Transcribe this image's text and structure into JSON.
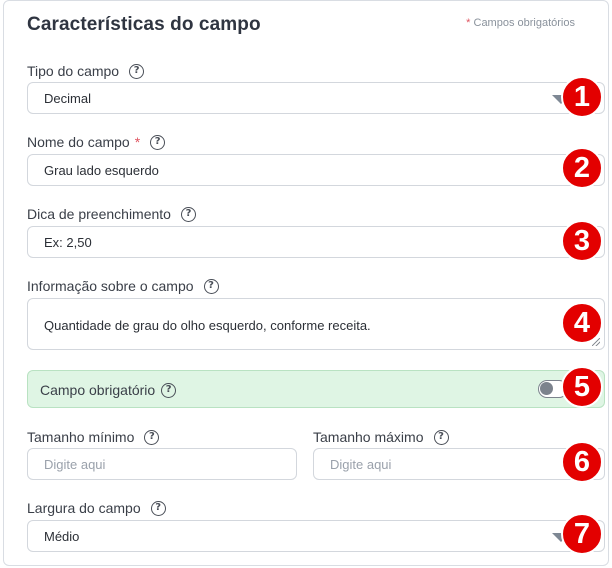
{
  "panel": {
    "title": "Características do campo",
    "required_note_star": "*",
    "required_note": "Campos obrigatórios"
  },
  "help_glyph": "?",
  "fields": {
    "tipo": {
      "label": "Tipo do campo",
      "value": "Decimal"
    },
    "nome": {
      "label": "Nome do campo",
      "required_star": "*",
      "value": "Grau lado esquerdo"
    },
    "dica": {
      "label": "Dica de preenchimento",
      "value": "Ex: 2,50"
    },
    "info": {
      "label": "Informação sobre o campo",
      "value": "Quantidade de grau do olho esquerdo, conforme receita."
    },
    "obrigatorio": {
      "label": "Campo obrigatório",
      "toggle_on": false
    },
    "tam_min": {
      "label": "Tamanho mínimo",
      "placeholder": "Digite aqui"
    },
    "tam_max": {
      "label": "Tamanho máximo",
      "placeholder": "Digite aqui"
    },
    "largura": {
      "label": "Largura do campo",
      "value": "Médio"
    }
  },
  "badges": [
    "1",
    "2",
    "3",
    "4",
    "5",
    "6",
    "7"
  ],
  "colors": {
    "badge": "#e30000",
    "required_star": "#e05561",
    "toggle_box_bg": "#dff5e4"
  }
}
